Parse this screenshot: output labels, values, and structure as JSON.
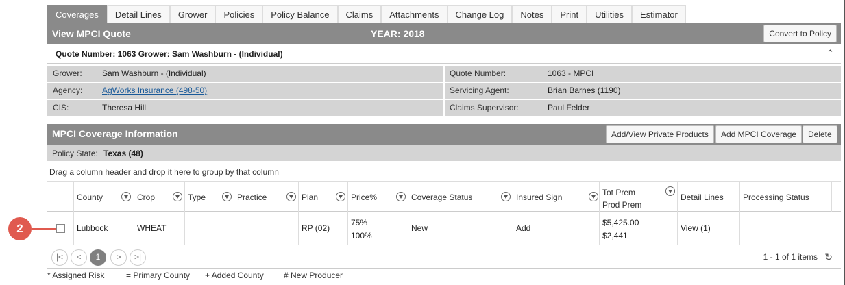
{
  "callout": "2",
  "tabs": [
    "Coverages",
    "Detail Lines",
    "Grower",
    "Policies",
    "Policy Balance",
    "Claims",
    "Attachments",
    "Change Log",
    "Notes",
    "Print",
    "Utilities",
    "Estimator"
  ],
  "header": {
    "title": "View MPCI Quote",
    "year": "YEAR: 2018",
    "convert_button": "Convert to Policy"
  },
  "quote_line": "Quote Number: 1063 Grower: Sam Washburn - (Individual)",
  "info": {
    "grower_label": "Grower:",
    "grower_value": "Sam Washburn - (Individual)",
    "agency_label": "Agency:",
    "agency_value": "AgWorks Insurance (498-50)",
    "cis_label": "CIS:",
    "cis_value": "Theresa Hill",
    "quote_number_label": "Quote Number:",
    "quote_number_value": "1063 - MPCI",
    "servicing_agent_label": "Servicing Agent:",
    "servicing_agent_value": "Brian Barnes (1190)",
    "claims_supervisor_label": "Claims Supervisor:",
    "claims_supervisor_value": "Paul Felder"
  },
  "coverage": {
    "title": "MPCI Coverage Information",
    "btn_private": "Add/View Private Products",
    "btn_add": "Add MPCI Coverage",
    "btn_delete": "Delete",
    "policy_state_label": "Policy State:",
    "policy_state_value": "Texas (48)",
    "group_hint": "Drag a column header and drop it here to group by that column"
  },
  "grid": {
    "headers": {
      "county": "County",
      "crop": "Crop",
      "type": "Type",
      "practice": "Practice",
      "plan": "Plan",
      "price": "Price%",
      "coverage_status": "Coverage Status",
      "insured_sign": "Insured Sign",
      "tot_prem": "Tot Prem",
      "prod_prem": "Prod Prem",
      "detail_lines": "Detail Lines",
      "processing_status": "Processing Status"
    },
    "row": {
      "county": "Lubbock",
      "crop": "WHEAT",
      "type": "",
      "practice": "",
      "plan": "RP (02)",
      "price_1": "75%",
      "price_2": "100%",
      "coverage_status": "New",
      "insured_sign": "Add",
      "tot_prem": "$5,425.00",
      "prod_prem": "$2,441",
      "detail_lines": "View (1)",
      "processing_status": ""
    }
  },
  "pager": {
    "first": "|<",
    "prev": "<",
    "page": "1",
    "next": ">",
    "last": ">|",
    "info": "1 - 1 of 1 items",
    "refresh": "↻"
  },
  "legend": {
    "assigned": "* Assigned Risk",
    "primary": "= Primary County",
    "added": "+ Added County",
    "new_producer": "# New Producer"
  }
}
